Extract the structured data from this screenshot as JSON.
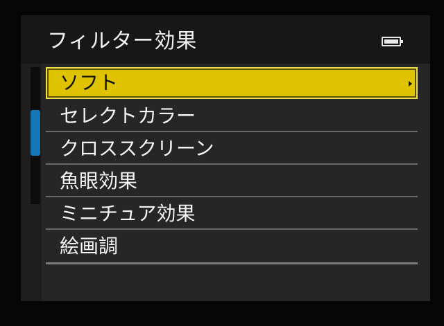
{
  "header": {
    "title": "フィルター効果",
    "battery_icon": "battery-full-icon"
  },
  "menu": {
    "items": [
      {
        "label": "ソフト",
        "selected": true,
        "has_submenu": true
      },
      {
        "label": "セレクトカラー",
        "selected": false
      },
      {
        "label": "クロススクリーン",
        "selected": false
      },
      {
        "label": "魚眼効果",
        "selected": false
      },
      {
        "label": "ミニチュア効果",
        "selected": false
      },
      {
        "label": "絵画調",
        "selected": false
      }
    ]
  },
  "colors": {
    "selection": "#e0c300",
    "scroll_indicator": "#1776b6",
    "background": "#1e1e1e",
    "text": "#f5f5f5"
  }
}
